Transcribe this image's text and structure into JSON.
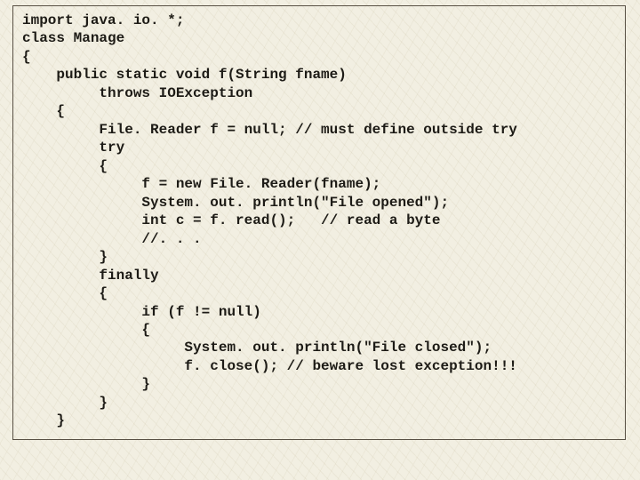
{
  "code": {
    "lines": [
      "import java. io. *;",
      "class Manage",
      "{",
      "    public static void f(String fname)",
      "         throws IOException",
      "    {",
      "         File. Reader f = null; // must define outside try",
      "         try",
      "         {",
      "              f = new File. Reader(fname);",
      "              System. out. println(\"File opened\");",
      "              int c = f. read();   // read a byte",
      "              //. . .",
      "         }",
      "         finally",
      "         {",
      "              if (f != null)",
      "              {",
      "                   System. out. println(\"File closed\");",
      "                   f. close(); // beware lost exception!!!",
      "              }",
      "         }",
      "    }"
    ]
  }
}
